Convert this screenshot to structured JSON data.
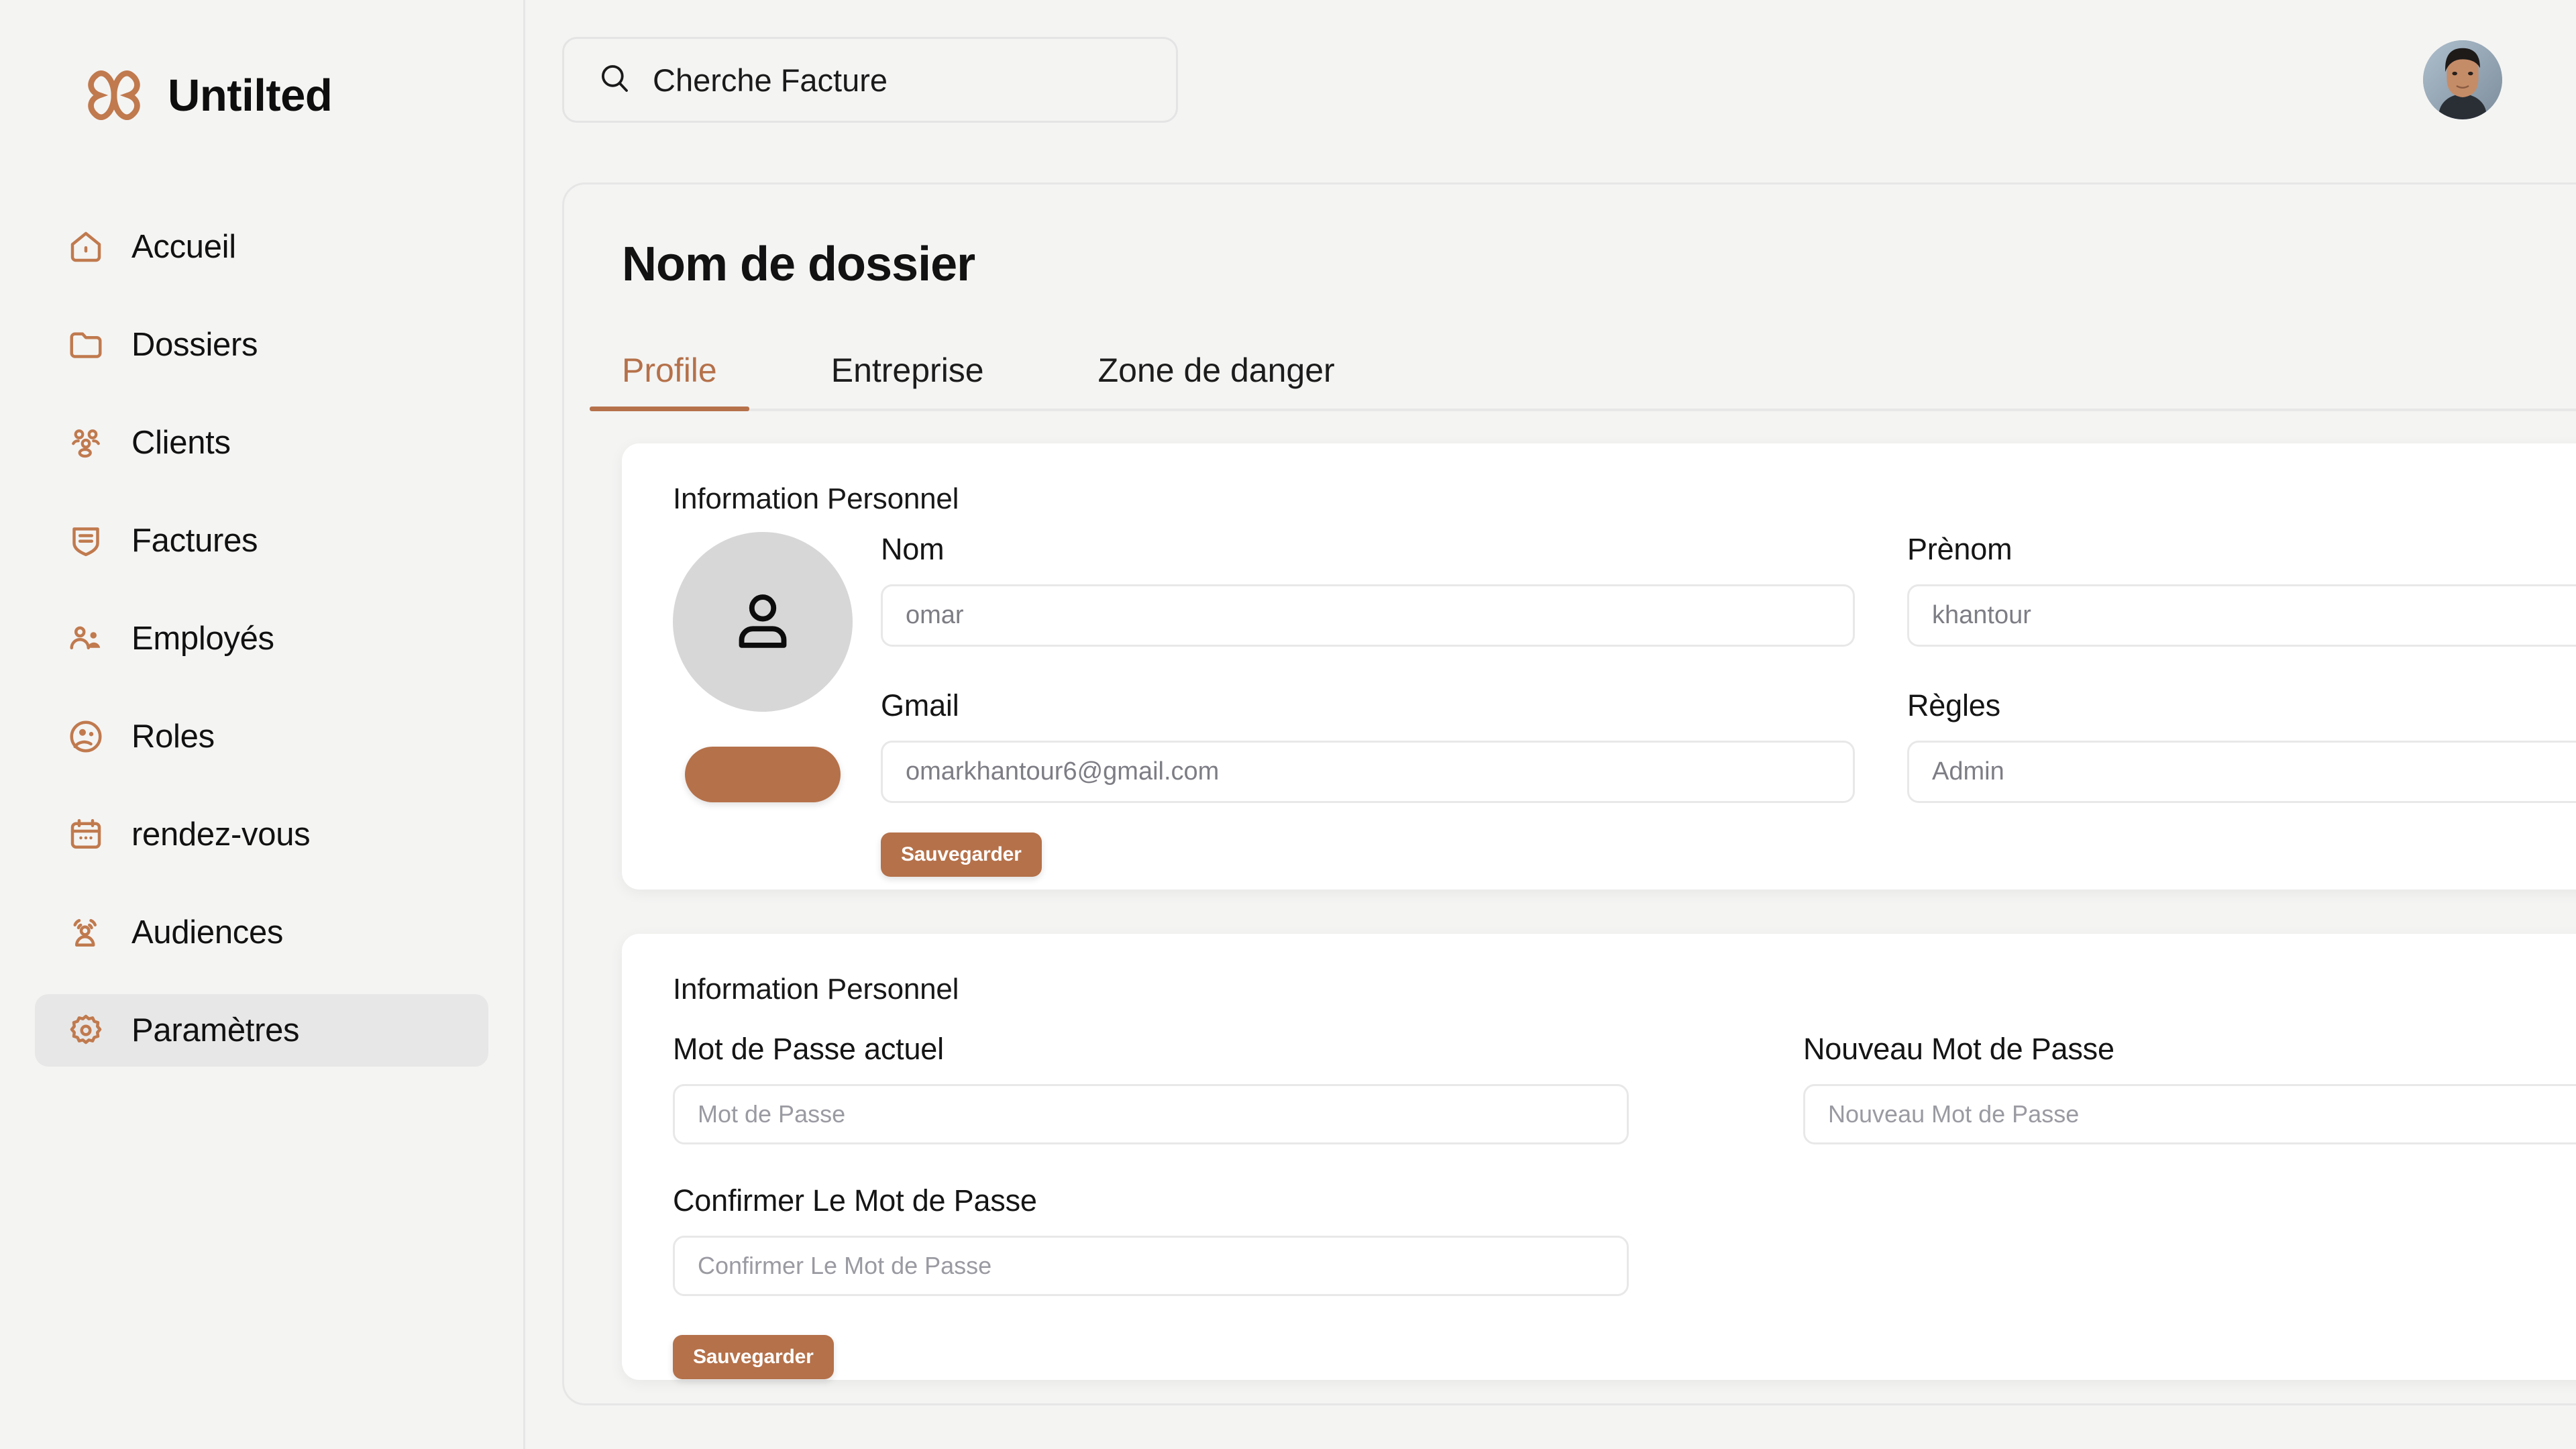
{
  "brand": {
    "name": "Untilted",
    "logo_icon": "infinity-knot-logo",
    "color": "#b5714a"
  },
  "sidebar": {
    "items": [
      {
        "label": "Accueil",
        "icon": "home-icon",
        "active": false
      },
      {
        "label": "Dossiers",
        "icon": "folder-icon",
        "active": false
      },
      {
        "label": "Clients",
        "icon": "users-group-icon",
        "active": false
      },
      {
        "label": "Factures",
        "icon": "invoice-shield-icon",
        "active": false
      },
      {
        "label": "Employés",
        "icon": "employee-icon",
        "active": false
      },
      {
        "label": "Roles",
        "icon": "role-badge-icon",
        "active": false
      },
      {
        "label": "rendez-vous",
        "icon": "calendar-icon",
        "active": false
      },
      {
        "label": "Audiences",
        "icon": "audience-icon",
        "active": false
      },
      {
        "label": "Paramètres",
        "icon": "gear-icon",
        "active": true
      }
    ]
  },
  "topbar": {
    "search": {
      "icon": "search-icon",
      "value": "Cherche Facture",
      "placeholder": "Cherche Facture"
    },
    "avatar": {
      "icon": "user-avatar-photo",
      "alt": "user-avatar"
    }
  },
  "page": {
    "title": "Nom de dossier",
    "tabs": [
      {
        "label": "Profile",
        "active": true
      },
      {
        "label": "Entreprise",
        "active": false
      },
      {
        "label": "Zone de danger",
        "active": false
      }
    ]
  },
  "profile_card": {
    "heading": "Information Personnel",
    "avatar_icon": "person-placeholder-icon",
    "upload_button_label": "",
    "fields": {
      "nom": {
        "label": "Nom",
        "value": "omar",
        "placeholder": "omar"
      },
      "prenom": {
        "label": "Prènom",
        "value": "khantour",
        "placeholder": "khantour"
      },
      "gmail": {
        "label": "Gmail",
        "value": "omarkhantour6@gmail.com",
        "placeholder": "omarkhantour6@gmail.com"
      },
      "regles": {
        "label": "Règles",
        "value": "Admin",
        "placeholder": "Admin"
      }
    },
    "save_label": "Sauvegarder"
  },
  "password_card": {
    "heading": "Information Personnel",
    "fields": {
      "current": {
        "label": "Mot de Passe actuel",
        "value": "",
        "placeholder": "Mot de Passe"
      },
      "new": {
        "label": "Nouveau Mot de Passe",
        "value": "",
        "placeholder": "Nouveau Mot de Passe"
      },
      "confirm": {
        "label": "Confirmer Le Mot de Passe",
        "value": "",
        "placeholder": "Confirmer Le Mot de Passe"
      }
    },
    "save_label": "Sauvegarder"
  },
  "colors": {
    "accent": "#b5714a",
    "page_bg": "#f4f4f3",
    "card_bg": "#ffffff",
    "border": "#e6e6e6"
  }
}
